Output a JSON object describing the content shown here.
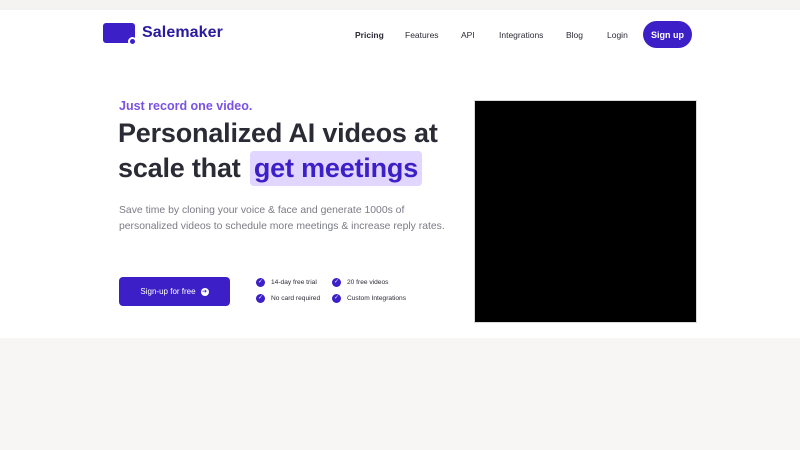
{
  "brand": {
    "name": "Salemaker",
    "color": "#3d1fc7"
  },
  "nav": {
    "items": [
      {
        "label": "Pricing",
        "active": true
      },
      {
        "label": "Features",
        "active": false
      },
      {
        "label": "API",
        "active": false
      },
      {
        "label": "Integrations",
        "active": false
      },
      {
        "label": "Blog",
        "active": false
      },
      {
        "label": "Login",
        "active": false
      }
    ],
    "signup_label": "Sign up"
  },
  "hero": {
    "eyebrow": "Just record one video.",
    "headline_line1": "Personalized AI videos at",
    "headline_line2_prefix": "scale that",
    "headline_highlight": "get meetings",
    "subtext": "Save time by cloning your voice & face and generate 1000s of personalized videos to schedule more meetings & increase reply rates.",
    "cta_label": "Sign-up for free",
    "cta_icon": "arrow-right-circle-icon",
    "features": [
      {
        "label": "14-day free trial",
        "icon": "check-circle-icon"
      },
      {
        "label": "20 free videos",
        "icon": "check-circle-icon"
      },
      {
        "label": "No card required",
        "icon": "check-circle-icon"
      },
      {
        "label": "Custom Integrations",
        "icon": "check-circle-icon"
      }
    ]
  },
  "colors": {
    "accent": "#3d1fc7",
    "eyebrow": "#7a52e6",
    "highlight_bg": "#e0d6ff",
    "video_bg": "#000000"
  }
}
